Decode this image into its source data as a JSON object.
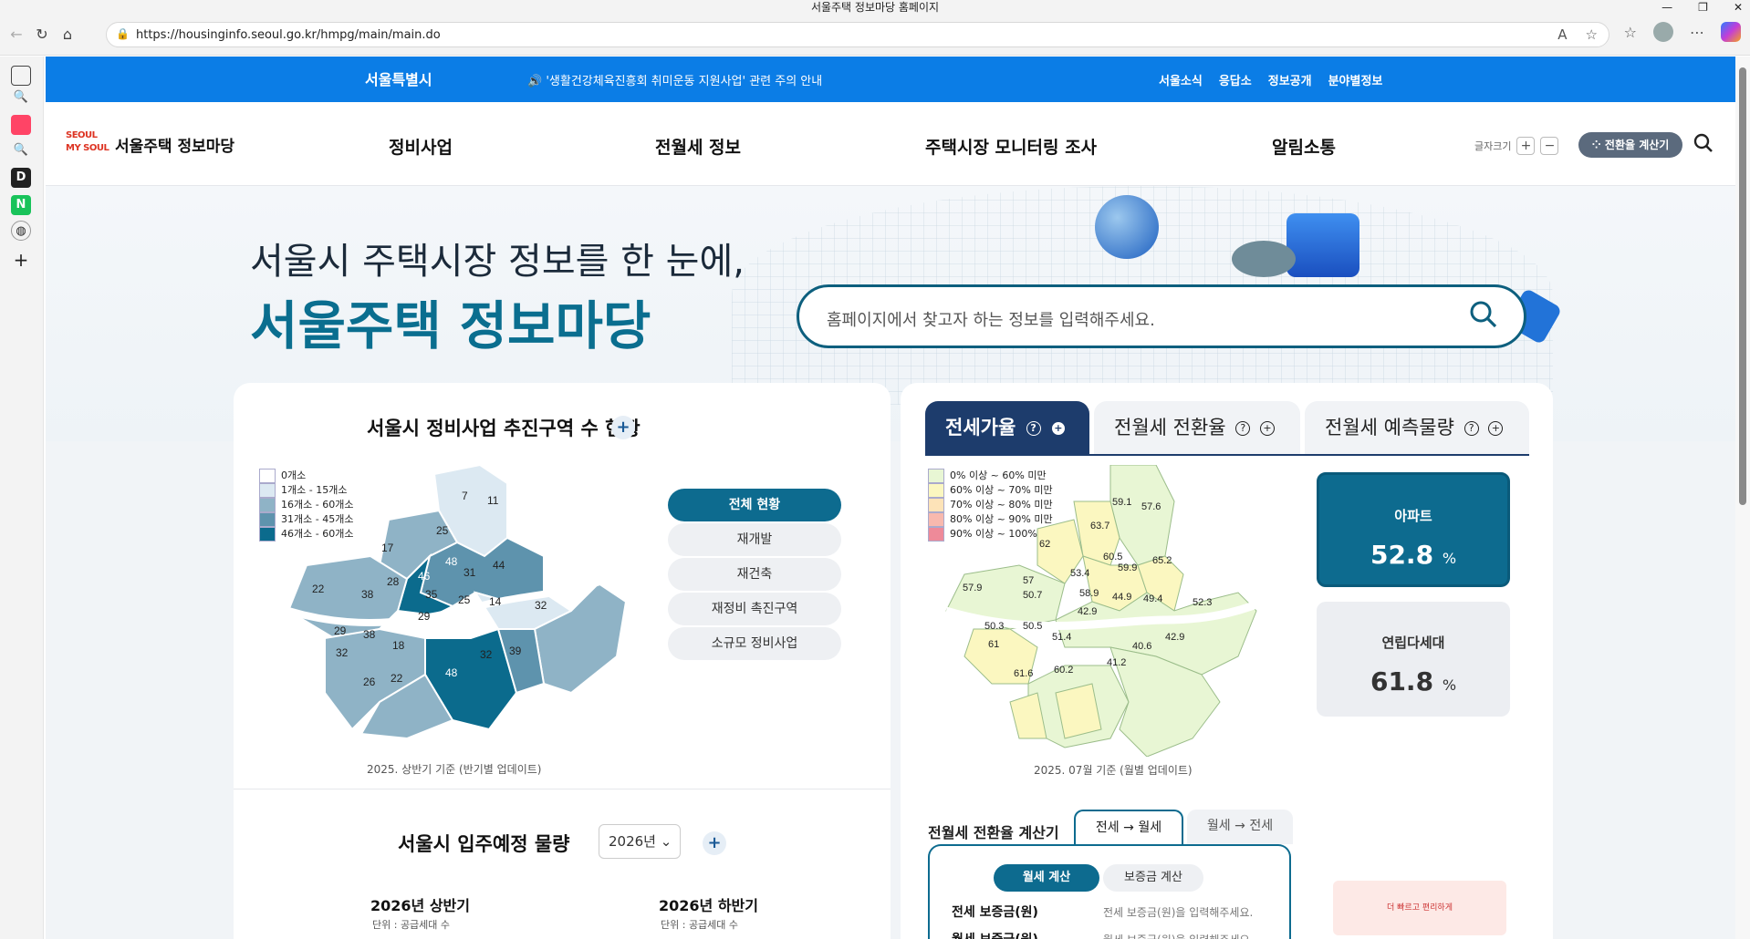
{
  "browser": {
    "window_title": "서울주택 정보마당 홈페이지",
    "url": "https://housinginfo.seoul.go.kr/hmpg/main/main.do"
  },
  "topbar": {
    "logo": "서울특별시",
    "notice": "'생활건강체육진흥회 취미운동 지원사업' 관련 주의 안내",
    "links": [
      "서울소식",
      "응답소",
      "정보공개",
      "분야별정보"
    ]
  },
  "gnb": {
    "brand": "서울주택 정보마당",
    "brand_logo_text": "SEOUL MY SOUL",
    "menu": [
      "정비사업",
      "전월세 정보",
      "주택시장 모니터링 조사",
      "알림소통"
    ],
    "font_size_label": "글자크기",
    "converter_button": "전환율 계산기"
  },
  "hero": {
    "line1": "서울시 주택시장 정보를 한 눈에,",
    "line2": "서울주택 정보마당",
    "search_placeholder": "홈페이지에서 찾고자 하는 정보를 입력해주세요."
  },
  "redev": {
    "title": "서울시 정비사업 추진구역 수 현황",
    "legend": [
      {
        "label": "0개소",
        "color": "#ffffff"
      },
      {
        "label": "1개소 - 15개소",
        "color": "#dce9f2"
      },
      {
        "label": "16개소 - 60개소",
        "color": "#8fb3c6"
      },
      {
        "label": "31개소 - 45개소",
        "color": "#5e93ad"
      },
      {
        "label": "46개소 - 60개소",
        "color": "#0b6b8d"
      }
    ],
    "map_values": [
      "7",
      "11",
      "25",
      "17",
      "48",
      "46",
      "31",
      "44",
      "28",
      "38",
      "35",
      "25",
      "14",
      "22",
      "29",
      "32",
      "38",
      "18",
      "29",
      "32",
      "39",
      "26",
      "22",
      "48",
      "32"
    ],
    "filters": [
      "전체 현황",
      "재개발",
      "재건축",
      "재정비 촉진구역",
      "소규모 정비사업"
    ],
    "caption": "2025. 상반기 기준 (반기별 업데이트)"
  },
  "supply": {
    "title": "서울시 입주예정 물량",
    "year": "2026년",
    "halves": [
      {
        "label": "2026년 상반기",
        "unit": "단위 : 공급세대 수"
      },
      {
        "label": "2026년 하반기",
        "unit": "단위 : 공급세대 수"
      }
    ]
  },
  "rent": {
    "tabs": [
      "전세가율",
      "전월세 전환율",
      "전월세 예측물량"
    ],
    "legend": [
      {
        "label": "0% 이상 ~ 60% 미만",
        "color": "#e8f6d4"
      },
      {
        "label": "60% 이상 ~ 70% 미만",
        "color": "#fbf7c0"
      },
      {
        "label": "70% 이상 ~ 80% 미만",
        "color": "#fde3b8"
      },
      {
        "label": "80% 이상 ~ 90% 미만",
        "color": "#f8b9ae"
      },
      {
        "label": "90% 이상 ~ 100% 미만",
        "color": "#ee8a99"
      }
    ],
    "map_values": [
      "59.1",
      "57.6",
      "63.7",
      "62",
      "60.5",
      "65.2",
      "53.4",
      "59.9",
      "57",
      "57.9",
      "50.7",
      "58.9",
      "44.9",
      "49.4",
      "52.3",
      "42.9",
      "50.3",
      "50.5",
      "51.4",
      "61",
      "42.9",
      "40.6",
      "41.2",
      "61.6",
      "60.2"
    ],
    "stats": [
      {
        "label": "아파트",
        "value": "52.8",
        "unit": "%"
      },
      {
        "label": "연립다세대",
        "value": "61.8",
        "unit": "%"
      }
    ],
    "caption": "2025. 07월 기준 (월별 업데이트)"
  },
  "calculator": {
    "title": "전월세 전환율 계산기",
    "tab_a": "전세 → 월세",
    "tab_b": "월세 → 전세",
    "pill_a": "월세 계산",
    "pill_b": "보증금 계산",
    "row1_label": "전세 보증금(원)",
    "row1_placeholder": "전세 보증금(원)을 입력해주세요.",
    "row2_label": "월세 보증금(원)",
    "row2_placeholder": "월세 보증금(원)을 입력해주세요."
  },
  "banner": {
    "text": "더 빠르고 편리하게"
  }
}
